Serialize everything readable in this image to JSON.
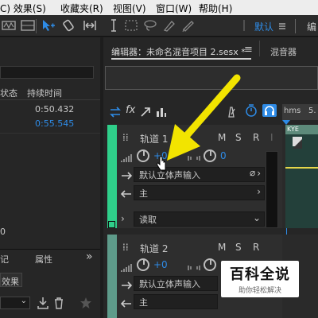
{
  "menu": [
    "C) 效果(S)",
    "收藏夹(R)",
    "视图(V)",
    "窗口(W)",
    "帮助(H)"
  ],
  "workspace": {
    "default_label": "默认",
    "edit_label": "编"
  },
  "left_panel": {
    "header_status": "状态",
    "header_duration": "持续时间",
    "durations": [
      "0:50.432",
      "0:55.545"
    ],
    "bottom_num": "0",
    "tab_a": "记",
    "tab_props": "属性",
    "effect_btn": "效果"
  },
  "editor": {
    "tab_title": "编辑器：未命名混音项目 2.sesx *",
    "menu_icon": "≡",
    "mixer_tab": "混音器",
    "fx_label": "fx",
    "ruler_label": "hms",
    "ruler_val": "5.",
    "clip_label": "KYE"
  },
  "tracks": [
    {
      "name": "轨道 1",
      "volume": "+0",
      "pan": "0",
      "m": "M",
      "s": "S",
      "r": "R",
      "i": "I",
      "input": "默认立体声输入",
      "output": "主",
      "mode": "读取"
    },
    {
      "name": "轨道 2",
      "volume": "+0",
      "pan": "",
      "m": "M",
      "s": "S",
      "r": "R",
      "i": "",
      "input": "默认立体声输入",
      "output": "主",
      "mode": ""
    }
  ],
  "watermark": {
    "title": "百科全说",
    "subtitle": "助你轻松解决"
  },
  "colors": {
    "accent": "#2e8be6",
    "track1": "#2fcf8a",
    "track2": "#5e9b8a",
    "arrow": "#f2e400"
  }
}
